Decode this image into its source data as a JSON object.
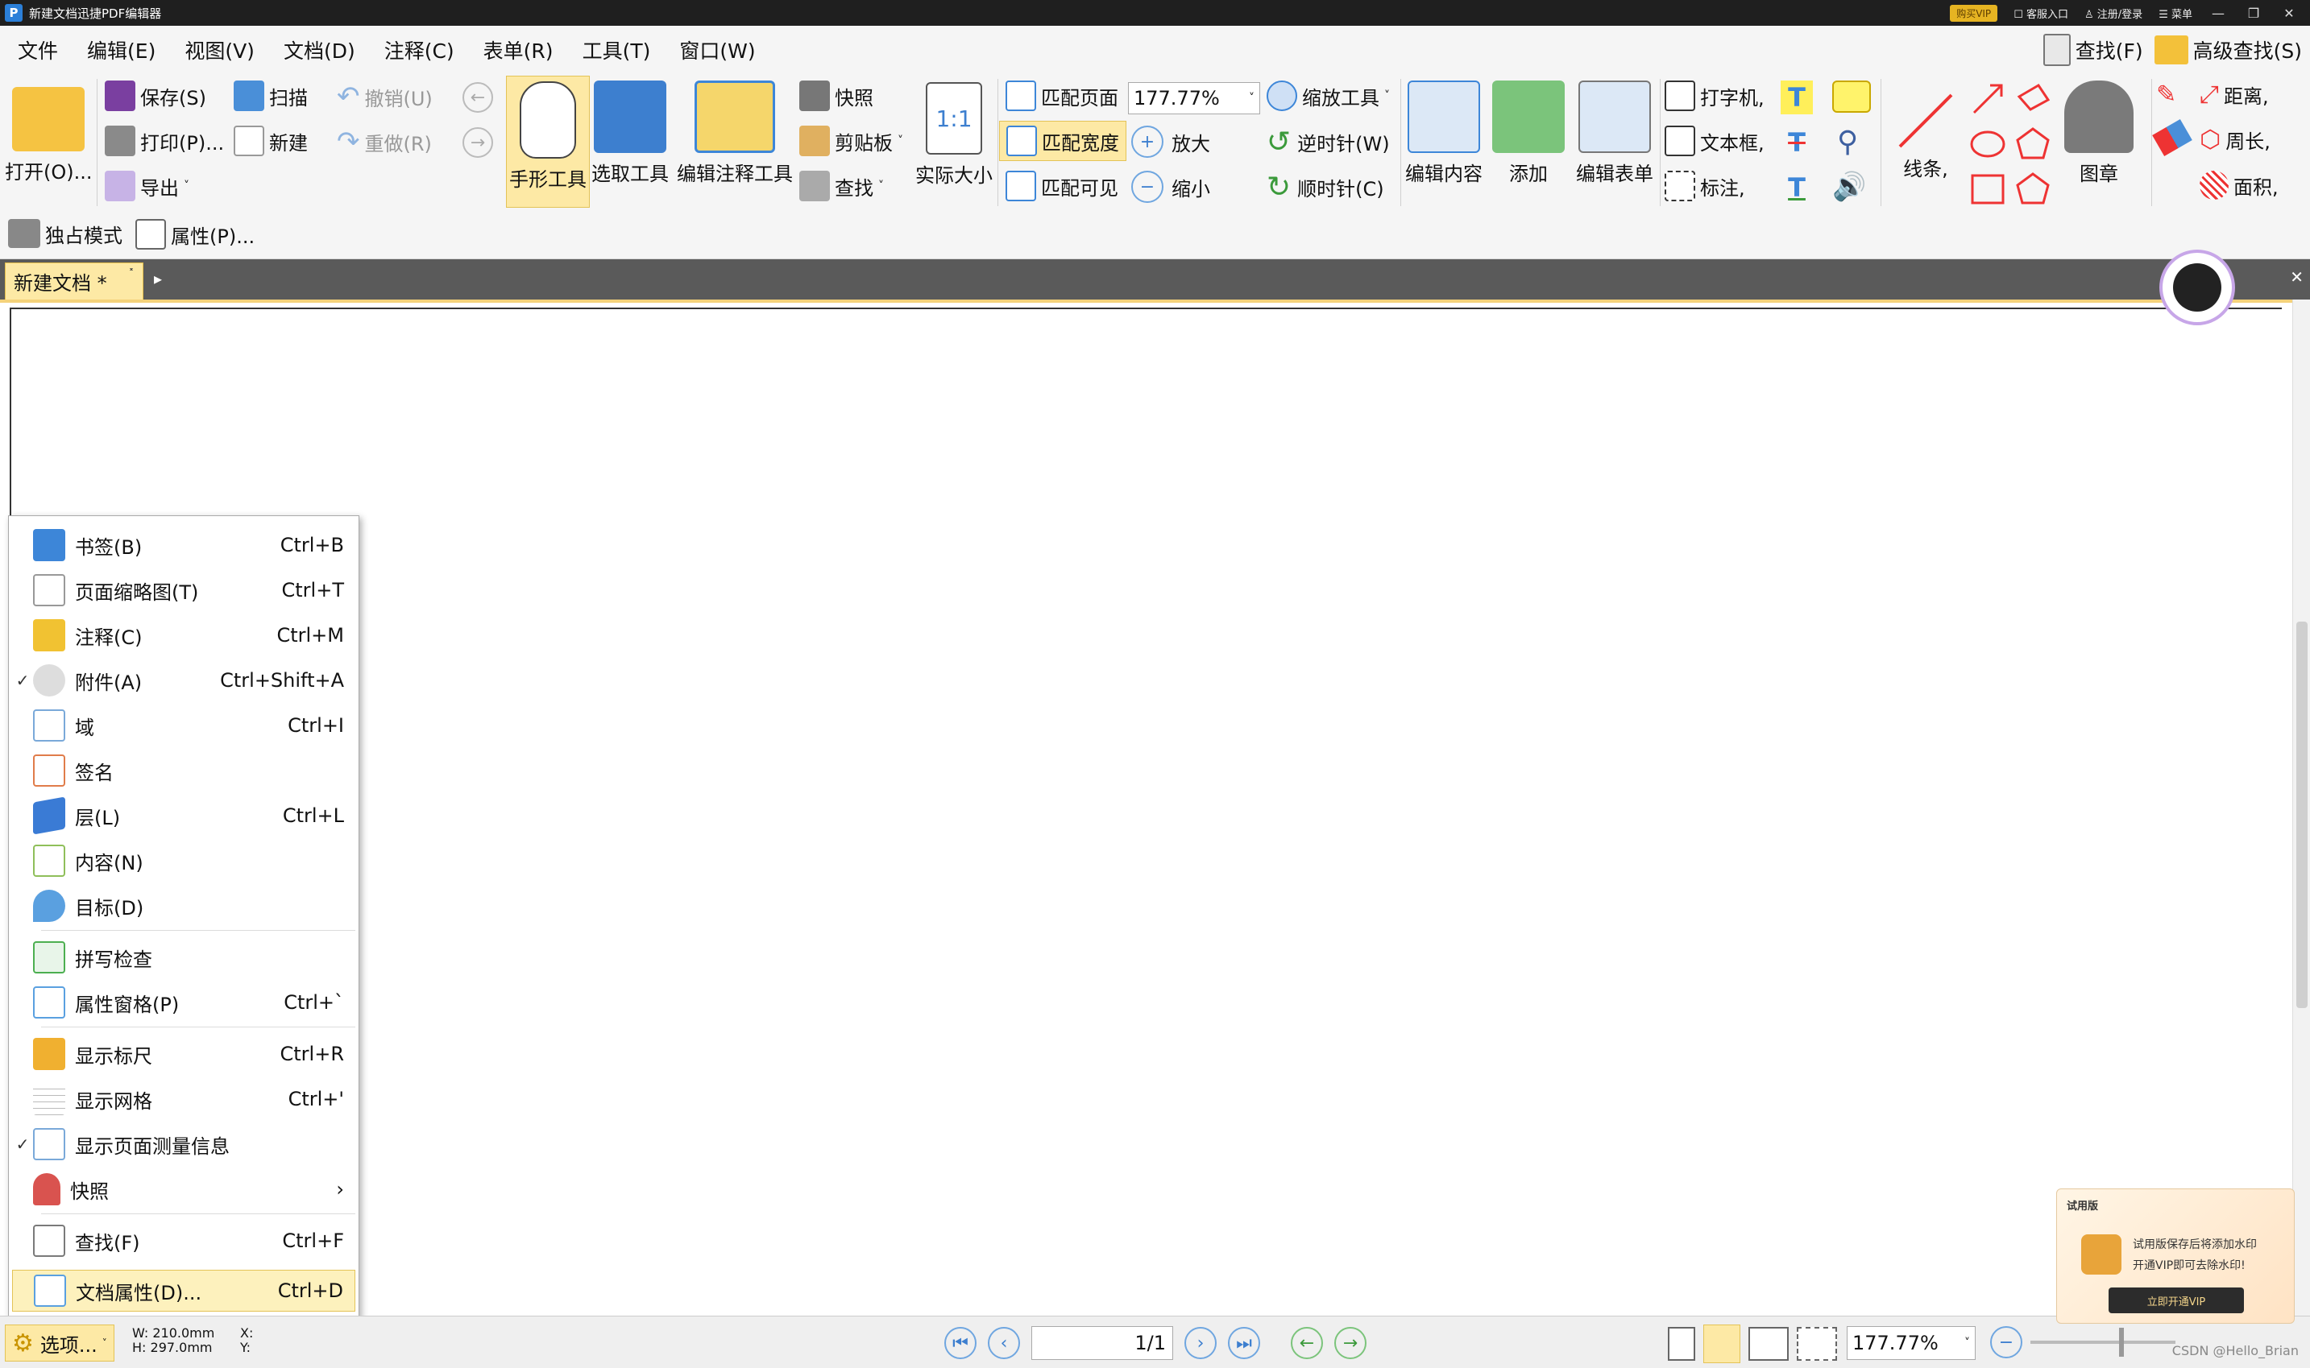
{
  "window": {
    "title": "新建文档迅捷PDF编辑器",
    "vip_badge": "购买VIP",
    "service": "客服入口",
    "login": "注册/登录",
    "menu": "菜单"
  },
  "menubar": {
    "items": [
      "文件",
      "编辑(E)",
      "视图(V)",
      "文档(D)",
      "注释(C)",
      "表单(R)",
      "工具(T)",
      "窗口(W)"
    ],
    "find": "查找(F)",
    "advanced_find": "高级查找(S)"
  },
  "ribbon": {
    "open": "打开(O)...",
    "save": "保存(S)",
    "print": "打印(P)...",
    "export": "导出",
    "scan": "扫描",
    "new": "新建",
    "undo": "撤销(U)",
    "redo": "重做(R)",
    "hand_tool": "手形工具",
    "select_tool": "选取工具",
    "edit_annotation_tool": "编辑注释工具",
    "snapshot": "快照",
    "clipboard": "剪贴板",
    "find": "查找",
    "actual_size": "实际大小",
    "actual_size_icon_text": "1:1",
    "fit_page": "匹配页面",
    "fit_width": "匹配宽度",
    "fit_visible": "匹配可见",
    "zoom_value": "177.77%",
    "zoom_in": "放大",
    "zoom_out": "缩小",
    "zoom_tool": "缩放工具",
    "rotate_ccw": "逆时针(W)",
    "rotate_cw": "顺时针(C)",
    "edit_content": "编辑内容",
    "add": "添加",
    "edit_form": "编辑表单",
    "typewriter": "打字机,",
    "textbox": "文本框,",
    "callout": "标注,",
    "lines": "线条,",
    "stamp": "图章",
    "distance": "距离,",
    "perimeter": "周长,",
    "area": "面积,"
  },
  "quickbar": {
    "exclusive_mode": "独占模式",
    "properties": "属性(P)..."
  },
  "tabs": {
    "doc_tab": "新建文档 *"
  },
  "view_menu": {
    "items": [
      {
        "label": "书签(B)",
        "shortcut": "Ctrl+B",
        "checked": "",
        "icon": "bookmark-icon",
        "color": "#3d86d8"
      },
      {
        "label": "页面缩略图(T)",
        "shortcut": "Ctrl+T",
        "checked": "",
        "icon": "thumbnails-icon",
        "color": "#c9c9c9"
      },
      {
        "label": "注释(C)",
        "shortcut": "Ctrl+M",
        "checked": "",
        "icon": "comment-icon",
        "color": "#f1c232"
      },
      {
        "label": "附件(A)",
        "shortcut": "Ctrl+Shift+A",
        "checked": "✓",
        "icon": "paperclip-icon",
        "color": "#9a9a9a"
      },
      {
        "label": "域",
        "shortcut": "Ctrl+I",
        "checked": "",
        "icon": "field-icon",
        "color": "#7aa9d9"
      },
      {
        "label": "签名",
        "shortcut": "",
        "checked": "",
        "icon": "signature-icon",
        "color": "#e07c4a"
      },
      {
        "label": "层(L)",
        "shortcut": "Ctrl+L",
        "checked": "",
        "icon": "layers-icon",
        "color": "#3a7bd5"
      },
      {
        "label": "内容(N)",
        "shortcut": "",
        "checked": "",
        "icon": "content-icon",
        "color": "#8fbf5a"
      },
      {
        "label": "目标(D)",
        "shortcut": "",
        "checked": "",
        "icon": "destination-icon",
        "color": "#5aa0e0"
      },
      {
        "label": "拼写检查",
        "shortcut": "",
        "checked": "",
        "icon": "spellcheck-icon",
        "color": "#4caf50"
      },
      {
        "label": "属性窗格(P)",
        "shortcut": "Ctrl+`",
        "checked": "",
        "icon": "properties-pane-icon",
        "color": "#5aa0e0"
      },
      {
        "label": "显示标尺",
        "shortcut": "Ctrl+R",
        "checked": "",
        "icon": "ruler-icon",
        "color": "#f0b030"
      },
      {
        "label": "显示网格",
        "shortcut": "Ctrl+'",
        "checked": "",
        "icon": "grid-icon",
        "color": "#9bb4d4"
      },
      {
        "label": "显示页面测量信息",
        "shortcut": "",
        "checked": "✓",
        "icon": "measure-info-icon",
        "color": "#7aa9d9"
      },
      {
        "label": "快照",
        "shortcut": "›",
        "checked": "",
        "icon": "magnet-icon",
        "color": "#d9534f"
      },
      {
        "label": "查找(F)",
        "shortcut": "Ctrl+F",
        "checked": "",
        "icon": "find-icon",
        "color": "#7a7a7a"
      },
      {
        "label": "文档属性(D)...",
        "shortcut": "Ctrl+D",
        "checked": "",
        "icon": "doc-properties-icon",
        "color": "#5aa0e0"
      }
    ]
  },
  "statusbar": {
    "options": "选项...",
    "width": "W: 210.0mm",
    "height": "H: 297.0mm",
    "coord_x": "X:",
    "coord_y": "Y:",
    "page_display": "1/1",
    "zoom_value": "177.77%"
  },
  "trial_popup": {
    "title": "试用版",
    "message1": "试用版保存后将添加水印",
    "message2": "开通VIP即可去除水印!",
    "button": "立即开通VIP"
  },
  "watermark": "CSDN @Hello_Brian",
  "colors": {
    "accent_yellow": "#fdf1bd",
    "tab_bg": "#5a5a5a",
    "title_bg": "#1f1f1f"
  }
}
